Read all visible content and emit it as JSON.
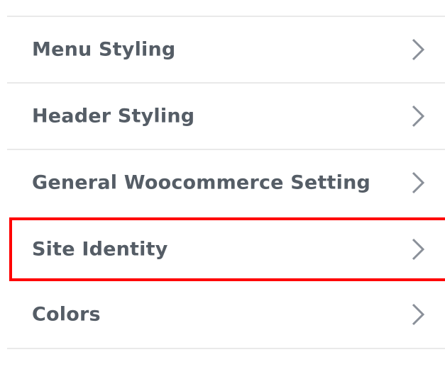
{
  "menu": {
    "items": [
      {
        "label": "Menu Styling",
        "icon": "chevron-right-icon"
      },
      {
        "label": "Header Styling",
        "icon": "chevron-right-icon"
      },
      {
        "label": "General Woocommerce Setting",
        "icon": "chevron-right-icon"
      },
      {
        "label": "Site Identity",
        "icon": "chevron-right-icon",
        "highlighted": true
      },
      {
        "label": "Colors",
        "icon": "chevron-right-icon"
      }
    ]
  },
  "colors": {
    "text": "#555d66",
    "chevron": "#8a9099",
    "divider": "#e9e9e9",
    "highlight": "#ff0000"
  }
}
